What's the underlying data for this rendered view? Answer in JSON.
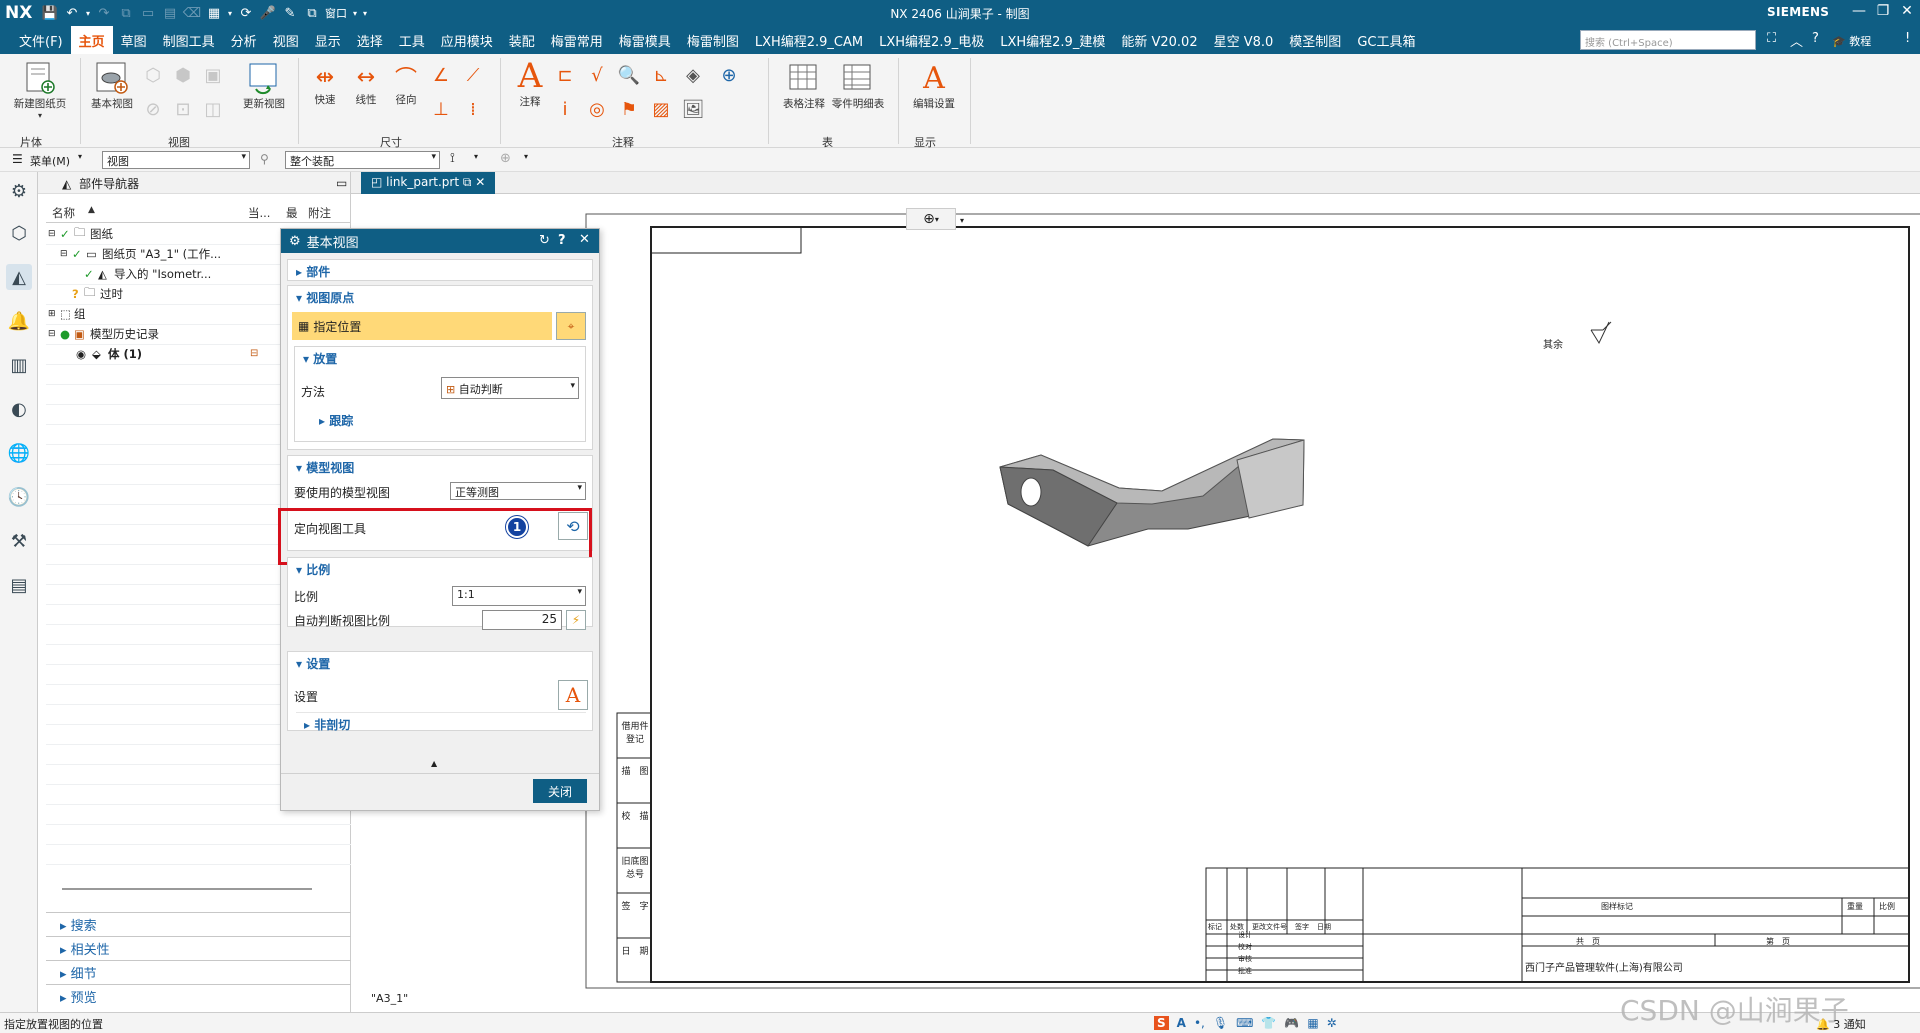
{
  "app": {
    "logo": "NX",
    "title": "NX 2406 山涧果子 - 制图",
    "brand": "SIEMENS",
    "brand_color": "#0f5e84",
    "accent_color": "#e6550c",
    "quick_access_icons": [
      "save-icon",
      "undo-icon",
      "redo-icon",
      "copy-icon",
      "paste-icon",
      "render-icon",
      "microphone-icon",
      "tools-icon",
      "window-icon"
    ],
    "window_menu": "窗口"
  },
  "menubar": {
    "items": [
      "文件(F)",
      "主页",
      "草图",
      "制图工具",
      "分析",
      "视图",
      "显示",
      "选择",
      "工具",
      "应用模块",
      "装配",
      "梅雷常用",
      "梅雷模具",
      "梅雷制图",
      "LXH编程2.9_CAM",
      "LXH编程2.9_电极",
      "LXH编程2.9_建模",
      "能新 V20.02",
      "星空 V8.0",
      "模圣制图",
      "GC工具箱"
    ],
    "active_index": 1,
    "search_placeholder": "搜索 (Ctrl+Space)",
    "help_label": "教程"
  },
  "ribbon": {
    "groups": {
      "sheet": "片体",
      "view": "视图",
      "dimension": "尺寸",
      "annotation": "注释",
      "table": "表",
      "display": "显示"
    },
    "buttons": {
      "new_sheet": "新建图纸页",
      "base_view": "基本视图",
      "update_view": "更新视图",
      "rapid": "快速",
      "linear": "线性",
      "radial": "径向",
      "note": "注释",
      "tabular_note": "表格注释",
      "parts_list": "零件明细表",
      "edit_settings": "编辑设置"
    }
  },
  "selbar": {
    "menu": "菜单(M)",
    "filter": "视图",
    "scope": "整个装配"
  },
  "navigator": {
    "title": "部件导航器",
    "columns": [
      "名称",
      "当...",
      "最",
      "附注"
    ],
    "tree": [
      {
        "label": "图纸"
      },
      {
        "label": "图纸页 \"A3_1\" (工作..."
      },
      {
        "label": "导入的 \"Isometr..."
      },
      {
        "label": "过时"
      },
      {
        "label": "组"
      },
      {
        "label": "模型历史记录"
      },
      {
        "label": "体 (1)"
      }
    ],
    "sections": [
      "搜索",
      "相关性",
      "细节",
      "预览"
    ]
  },
  "dialog": {
    "title": "基本视图",
    "part": "部件",
    "view_origin": "视图原点",
    "specify_location": "指定位置",
    "placement": "放置",
    "method_label": "方法",
    "method_value": "自动判断",
    "tracking": "跟踪",
    "model_view": "模型视图",
    "model_view_label": "要使用的模型视图",
    "model_view_value": "正等测图",
    "orient_tool": "定向视图工具",
    "badge": "1",
    "scale_section": "比例",
    "scale_label": "比例",
    "scale_value": "1:1",
    "auto_scale_label": "自动判断视图比例",
    "auto_scale_value": "25",
    "settings_section": "设置",
    "settings_label": "设置",
    "non_section": "非剖切",
    "close": "关闭"
  },
  "document": {
    "tab": "link_part.prt",
    "sheet_label": "\"A3_1\"",
    "rough_symbol": "其余",
    "left_strip": [
      "借用件登记",
      "描　图",
      "校　描",
      "旧底图总号",
      "签　字",
      "日　期"
    ],
    "titleblock": {
      "rev_headers": [
        "标记",
        "处数",
        "更改文件号",
        "签字",
        "日期"
      ],
      "roles": [
        "设计",
        "校对",
        "审核",
        "批准"
      ],
      "stage": "图样标记",
      "weight": "重量",
      "scale": "比例",
      "sheets_total": "共　页",
      "sheet_no": "第　页",
      "company": "西门子产品管理软件(上海)有限公司"
    }
  },
  "status": {
    "prompt": "指定放置视图的位置",
    "notifications": "3 通知",
    "watermark": "CSDN @山涧果子"
  }
}
